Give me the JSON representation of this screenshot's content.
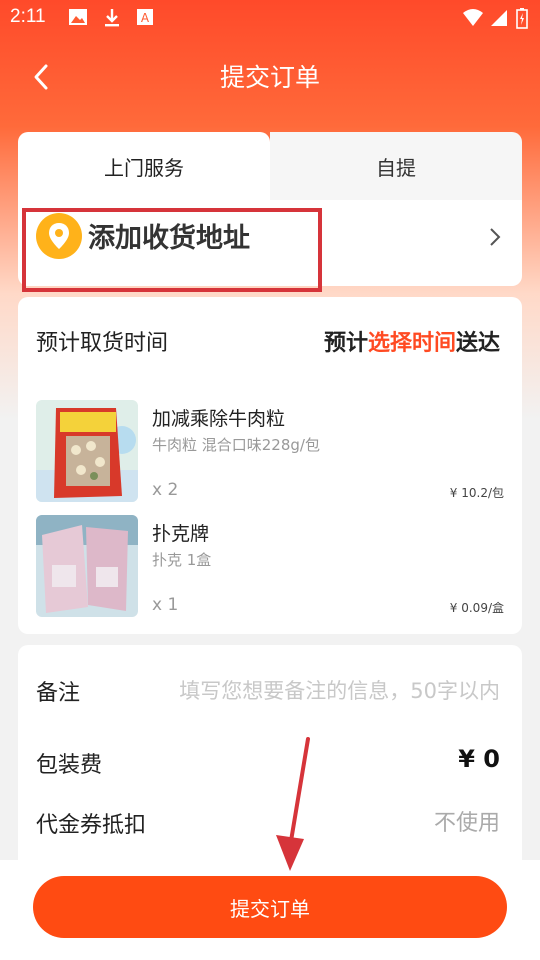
{
  "status_bar": {
    "time": "2:11"
  },
  "nav": {
    "title": "提交订单"
  },
  "tabs": [
    {
      "label": "上门服务",
      "active": true
    },
    {
      "label": "自提",
      "active": false
    }
  ],
  "address": {
    "label": "添加收货地址"
  },
  "pickup": {
    "label": "预计取货时间",
    "prefix": "预计",
    "select": "选择时间",
    "suffix": "送达"
  },
  "items": [
    {
      "name": "加减乘除牛肉粒",
      "spec": "牛肉粒 混合口味228g/包",
      "qty": "x 2",
      "price": "¥ 10.2/包"
    },
    {
      "name": "扑克牌",
      "spec": "扑克 1盒",
      "qty": "x 1",
      "price": "¥ 0.09/盒"
    }
  ],
  "note": {
    "label": "备注",
    "placeholder": "填写您想要备注的信息，50字以内"
  },
  "packing_fee": {
    "label": "包装费",
    "value": "¥ 0"
  },
  "coupon": {
    "label": "代金券抵扣",
    "value": "不使用"
  },
  "submit": {
    "label": "提交订单"
  },
  "colors": {
    "brand": "#ff4b12",
    "highlight": "#ff4a22",
    "annotation": "#d6343a"
  }
}
